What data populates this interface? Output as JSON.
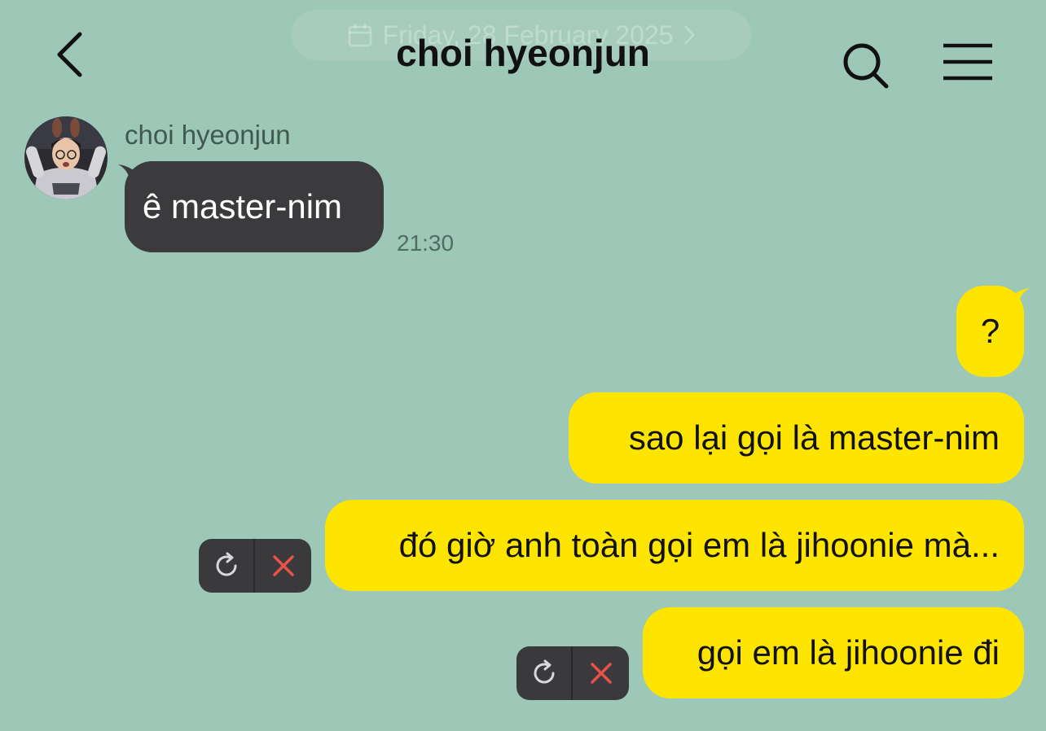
{
  "header": {
    "date_label": "Friday, 28 February 2025",
    "chat_title": "choi hyeonjun",
    "back_icon": "chevron-left-icon",
    "search_icon": "search-icon",
    "menu_icon": "hamburger-menu-icon"
  },
  "messages_received": [
    {
      "sender": "choi hyeonjun",
      "text": "ê master-nim",
      "time": "21:30"
    }
  ],
  "messages_sent": [
    {
      "text": "?"
    },
    {
      "text": "sao lại gọi là master-nim"
    },
    {
      "text": "đó giờ anh toàn gọi em là jihoonie mà...",
      "status": "failed"
    },
    {
      "text": "gọi em là jihoonie đi",
      "status": "failed"
    }
  ],
  "failed_controls": {
    "retry_icon": "retry-icon",
    "delete_icon": "close-icon"
  },
  "colors": {
    "background": "#9dc7b6",
    "sent_bubble": "#fee500",
    "received_bubble": "#3b3b3d",
    "delete_accent": "#e8524a"
  }
}
